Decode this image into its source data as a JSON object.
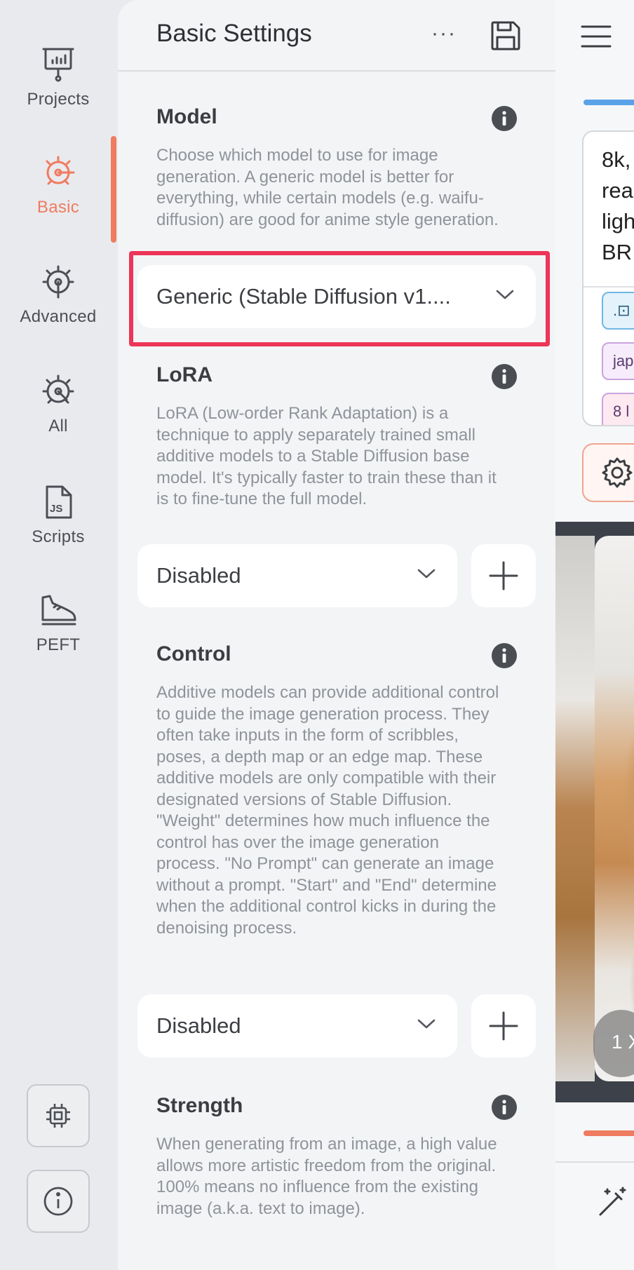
{
  "nav": {
    "items": [
      {
        "label": "Projects",
        "icon": "presentation-icon"
      },
      {
        "label": "Basic",
        "icon": "basic-settings-icon",
        "active": true
      },
      {
        "label": "Advanced",
        "icon": "advanced-settings-icon"
      },
      {
        "label": "All",
        "icon": "all-settings-icon"
      },
      {
        "label": "Scripts",
        "icon": "js-file-icon"
      },
      {
        "label": "PEFT",
        "icon": "sneaker-icon"
      }
    ],
    "bottom_buttons": [
      {
        "icon": "chip-icon"
      },
      {
        "icon": "info-icon"
      }
    ],
    "accent_color": "#ef7b60"
  },
  "panel": {
    "title": "Basic Settings",
    "more_label": "···",
    "sections": {
      "model": {
        "title": "Model",
        "description": "Choose which model to use for image generation. A generic model is better for everything, while certain models (e.g. waifu-diffusion) are good for anime style generation.",
        "selected": "Generic (Stable Diffusion v1...."
      },
      "lora": {
        "title": "LoRA",
        "description": "LoRA (Low-order Rank Adaptation) is a technique to apply separately trained small additive models to a Stable Diffusion base model. It's typically faster to train these than it is to fine-tune the full model.",
        "selected": "Disabled"
      },
      "control": {
        "title": "Control",
        "description": "Additive models can provide additional control to guide the image generation process. They often take inputs in the form of scribbles, poses, a depth map or an edge map. These additive models are only compatible with their designated versions of Stable Diffusion. \"Weight\" determines how much influence the control has over the image generation process. \"No Prompt\" can generate an image without a prompt. \"Start\" and \"End\" determine when the additional control kicks in during the denoising process.",
        "selected": "Disabled"
      },
      "strength": {
        "title": "Strength",
        "description": "When generating from an image, a high value allows more artistic freedom from the original. 100% means no influence from the existing image (a.k.a. text to image)."
      }
    },
    "highlight_color": "#ec3557"
  },
  "preview": {
    "prompt_text": "8k,\nrea\nligh\nBR",
    "chips": [
      ".⊡",
      "jap",
      "8 l"
    ],
    "count_label": "1 X"
  }
}
